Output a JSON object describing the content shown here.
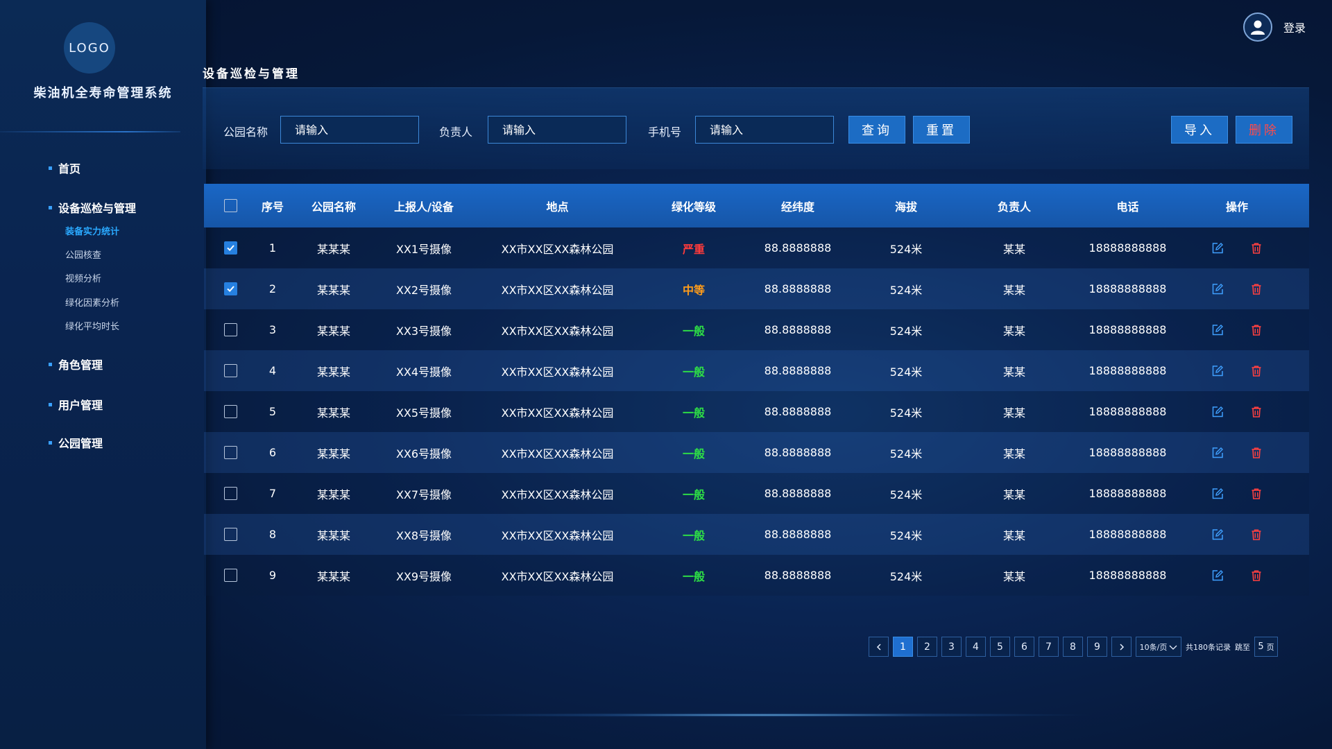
{
  "app": {
    "logo_text": "LOGO",
    "system_title": "柴油机全寿命管理系统",
    "login_label": "登录"
  },
  "sidebar": {
    "items": [
      {
        "label": "首页"
      },
      {
        "label": "设备巡检与管理"
      },
      {
        "label": "角色管理"
      },
      {
        "label": "用户管理"
      },
      {
        "label": "公园管理"
      }
    ],
    "sub_items": [
      {
        "label": "装备实力统计",
        "active": true
      },
      {
        "label": "公园核查"
      },
      {
        "label": "视频分析"
      },
      {
        "label": "绿化因素分析"
      },
      {
        "label": "绿化平均时长"
      }
    ]
  },
  "page": {
    "title": "设备巡检与管理"
  },
  "filters": {
    "park_label": "公园名称",
    "park_placeholder": "请输入",
    "owner_label": "负责人",
    "owner_placeholder": "请输入",
    "phone_label": "手机号",
    "phone_placeholder": "请输入",
    "query_button": "查询",
    "reset_button": "重置",
    "import_button": "导入",
    "delete_button": "删除"
  },
  "table": {
    "headers": {
      "index": "序号",
      "park": "公园名称",
      "reporter": "上报人/设备",
      "location": "地点",
      "grade": "绿化等级",
      "lnglat": "经纬度",
      "altitude": "海拔",
      "owner": "负责人",
      "phone": "电话",
      "ops": "操作"
    },
    "rows": [
      {
        "checked": true,
        "index": "1",
        "park": "某某某",
        "reporter": "XX1号摄像",
        "location": "XX市XX区XX森林公园",
        "grade": "严重",
        "grade_level": "severe",
        "lnglat": "88.8888888",
        "altitude": "524米",
        "owner": "某某",
        "phone": "18888888888"
      },
      {
        "checked": true,
        "index": "2",
        "park": "某某某",
        "reporter": "XX2号摄像",
        "location": "XX市XX区XX森林公园",
        "grade": "中等",
        "grade_level": "medium",
        "lnglat": "88.8888888",
        "altitude": "524米",
        "owner": "某某",
        "phone": "18888888888"
      },
      {
        "checked": false,
        "index": "3",
        "park": "某某某",
        "reporter": "XX3号摄像",
        "location": "XX市XX区XX森林公园",
        "grade": "一般",
        "grade_level": "normal",
        "lnglat": "88.8888888",
        "altitude": "524米",
        "owner": "某某",
        "phone": "18888888888"
      },
      {
        "checked": false,
        "index": "4",
        "park": "某某某",
        "reporter": "XX4号摄像",
        "location": "XX市XX区XX森林公园",
        "grade": "一般",
        "grade_level": "normal",
        "lnglat": "88.8888888",
        "altitude": "524米",
        "owner": "某某",
        "phone": "18888888888"
      },
      {
        "checked": false,
        "index": "5",
        "park": "某某某",
        "reporter": "XX5号摄像",
        "location": "XX市XX区XX森林公园",
        "grade": "一般",
        "grade_level": "normal",
        "lnglat": "88.8888888",
        "altitude": "524米",
        "owner": "某某",
        "phone": "18888888888"
      },
      {
        "checked": false,
        "index": "6",
        "park": "某某某",
        "reporter": "XX6号摄像",
        "location": "XX市XX区XX森林公园",
        "grade": "一般",
        "grade_level": "normal",
        "lnglat": "88.8888888",
        "altitude": "524米",
        "owner": "某某",
        "phone": "18888888888"
      },
      {
        "checked": false,
        "index": "7",
        "park": "某某某",
        "reporter": "XX7号摄像",
        "location": "XX市XX区XX森林公园",
        "grade": "一般",
        "grade_level": "normal",
        "lnglat": "88.8888888",
        "altitude": "524米",
        "owner": "某某",
        "phone": "18888888888"
      },
      {
        "checked": false,
        "index": "8",
        "park": "某某某",
        "reporter": "XX8号摄像",
        "location": "XX市XX区XX森林公园",
        "grade": "一般",
        "grade_level": "normal",
        "lnglat": "88.8888888",
        "altitude": "524米",
        "owner": "某某",
        "phone": "18888888888"
      },
      {
        "checked": false,
        "index": "9",
        "park": "某某某",
        "reporter": "XX9号摄像",
        "location": "XX市XX区XX森林公园",
        "grade": "一般",
        "grade_level": "normal",
        "lnglat": "88.8888888",
        "altitude": "524米",
        "owner": "某某",
        "phone": "18888888888"
      }
    ]
  },
  "pagination": {
    "prev_icon": "chevron-left-icon",
    "next_icon": "chevron-right-icon",
    "pages": [
      "1",
      "2",
      "3",
      "4",
      "5",
      "6",
      "7",
      "8",
      "9"
    ],
    "current": "1",
    "page_size": "10条/页",
    "total_text": "共180条记录",
    "jump_label": "跳至",
    "jump_value": "5",
    "page_unit": "页"
  },
  "colors": {
    "accent": "#1c6cc4",
    "severe": "#ff3b3b",
    "medium": "#ff9c1a",
    "normal": "#2ee045",
    "edit_icon": "#3fa0ff",
    "delete_icon": "#ff4040"
  },
  "icons": {
    "avatar": "user-avatar-icon",
    "edit": "edit-icon",
    "delete": "trash-icon"
  }
}
